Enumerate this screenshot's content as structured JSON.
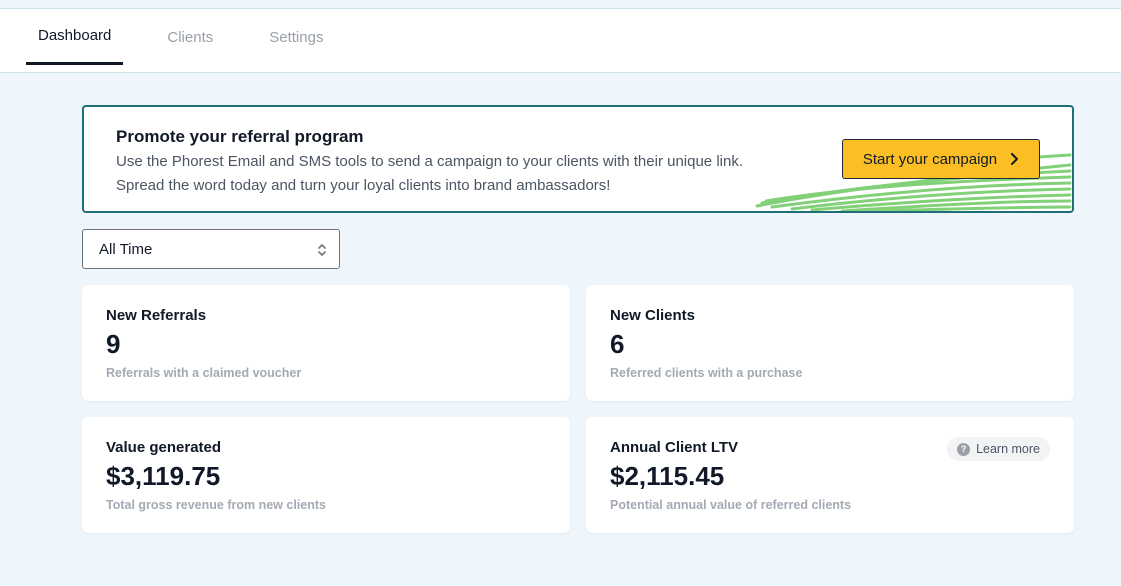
{
  "tabs": [
    {
      "label": "Dashboard",
      "active": true
    },
    {
      "label": "Clients",
      "active": false
    },
    {
      "label": "Settings",
      "active": false
    }
  ],
  "banner": {
    "title": "Promote your referral program",
    "line1": "Use the Phorest Email and SMS tools to send a campaign to your clients with their unique link.",
    "line2": "Spread the word today and turn your loyal clients into brand ambassadors!",
    "cta_label": "Start your campaign",
    "cta_icon": "chevron-right-icon",
    "accent_color": "#fbbf24",
    "border_color": "#1f6f7a"
  },
  "filter": {
    "selected": "All Time",
    "icon": "up-down-arrows-icon"
  },
  "cards": {
    "referrals": {
      "title": "New Referrals",
      "value": "9",
      "desc": "Referrals with a claimed voucher"
    },
    "clients": {
      "title": "New Clients",
      "value": "6",
      "desc": "Referred clients with a purchase"
    },
    "value": {
      "title": "Value generated",
      "value": "$3,119.75",
      "desc": "Total gross revenue from new clients"
    },
    "ltv": {
      "title": "Annual Client LTV",
      "value": "$2,115.45",
      "desc": "Potential annual value of referred clients",
      "learn_more": "Learn more",
      "learn_icon": "question-circle-icon"
    }
  }
}
